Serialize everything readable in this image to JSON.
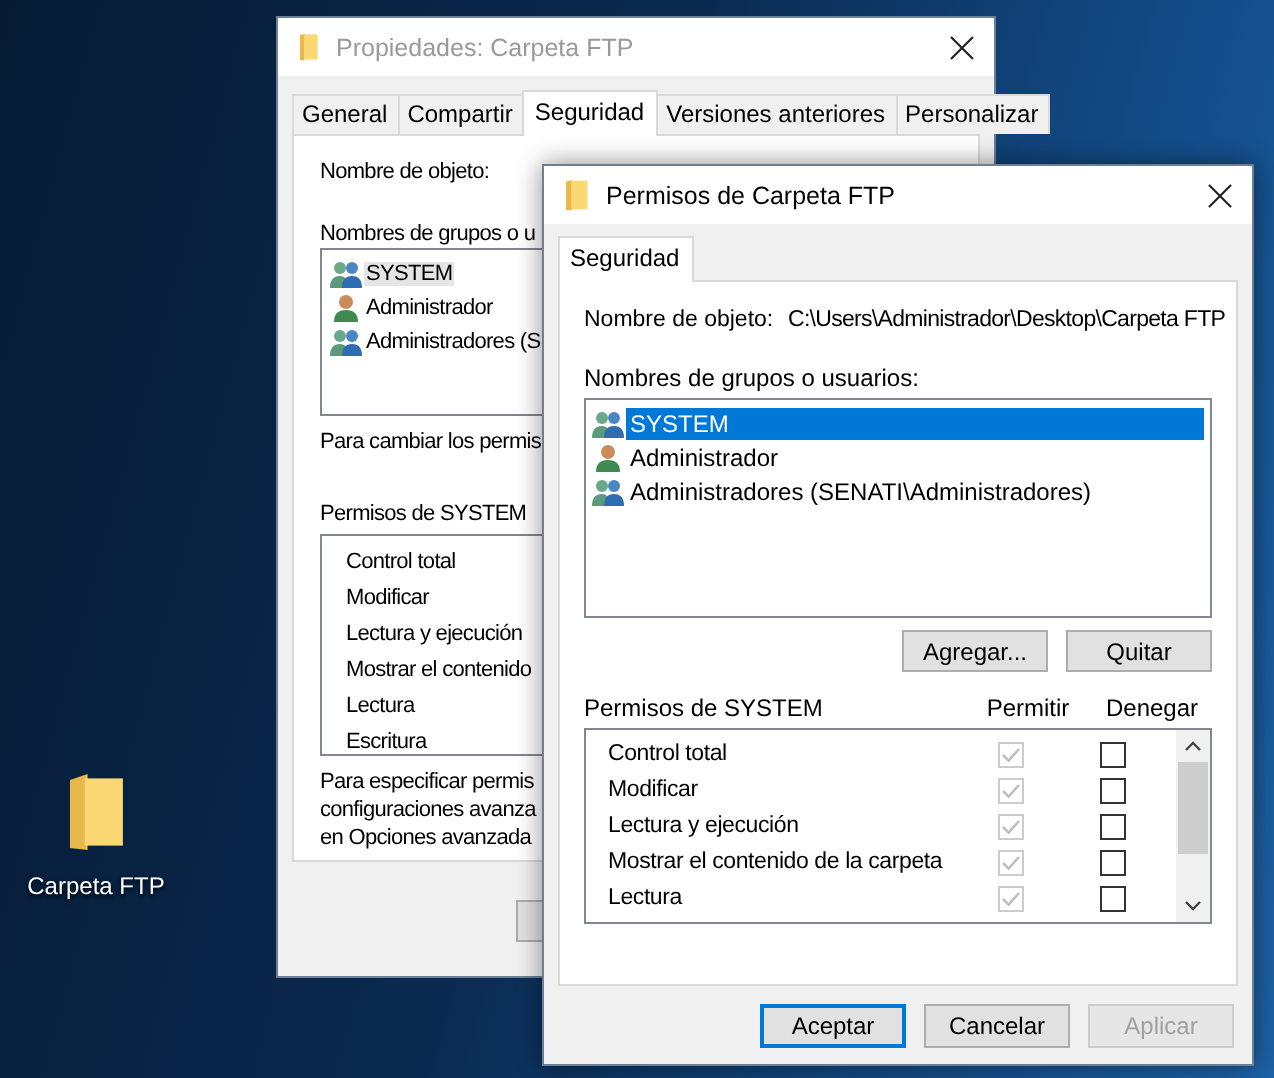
{
  "desktop": {
    "icons": [
      {
        "label": "Carpeta FTP"
      }
    ]
  },
  "back_window": {
    "title": "Propiedades: Carpeta FTP",
    "tabs": [
      {
        "label": "General",
        "selected": false
      },
      {
        "label": "Compartir",
        "selected": false
      },
      {
        "label": "Seguridad",
        "selected": true
      },
      {
        "label": "Versiones anteriores",
        "selected": false
      },
      {
        "label": "Personalizar",
        "selected": false
      }
    ],
    "object_label": "Nombre de objeto:",
    "groups_label": "Nombres de grupos o u",
    "groups": [
      {
        "name": "SYSTEM",
        "kind": "group",
        "selected": true
      },
      {
        "name": "Administrador",
        "kind": "user",
        "selected": false
      },
      {
        "name": "Administradores (S",
        "kind": "group",
        "selected": false
      }
    ],
    "change_note": "Para cambiar los permis",
    "permissions_label": "Permisos de SYSTEM",
    "permissions": [
      "Control total",
      "Modificar",
      "Lectura y ejecución",
      "Mostrar el contenido",
      "Lectura",
      "Escritura"
    ],
    "advanced_note": [
      "Para especificar permis",
      "configuraciones avanza",
      "en Opciones avanzada"
    ]
  },
  "front_window": {
    "title": "Permisos de Carpeta FTP",
    "tabs": [
      {
        "label": "Seguridad",
        "selected": true
      }
    ],
    "object_label": "Nombre de objeto:",
    "object_path": "C:\\Users\\Administrador\\Desktop\\Carpeta FTP",
    "groups_label": "Nombres de grupos o usuarios:",
    "groups": [
      {
        "name": "SYSTEM",
        "kind": "group",
        "selected": true
      },
      {
        "name": "Administrador",
        "kind": "user",
        "selected": false
      },
      {
        "name": "Administradores (SENATI\\Administradores)",
        "kind": "group",
        "selected": false
      }
    ],
    "group_buttons": [
      "Agregar...",
      "Quitar"
    ],
    "permissions_label": "Permisos de SYSTEM",
    "allow_label": "Permitir",
    "deny_label": "Denegar",
    "permissions": [
      {
        "name": "Control total",
        "allow": {
          "checked": true,
          "disabled": true
        },
        "deny": {
          "checked": false,
          "disabled": false
        }
      },
      {
        "name": "Modificar",
        "allow": {
          "checked": true,
          "disabled": true
        },
        "deny": {
          "checked": false,
          "disabled": false
        }
      },
      {
        "name": "Lectura y ejecución",
        "allow": {
          "checked": true,
          "disabled": true
        },
        "deny": {
          "checked": false,
          "disabled": false
        }
      },
      {
        "name": "Mostrar el contenido de la carpeta",
        "allow": {
          "checked": true,
          "disabled": true
        },
        "deny": {
          "checked": false,
          "disabled": false
        }
      },
      {
        "name": "Lectura",
        "allow": {
          "checked": true,
          "disabled": true
        },
        "deny": {
          "checked": false,
          "disabled": false
        }
      }
    ],
    "buttons": [
      {
        "label": "Aceptar",
        "focused": true,
        "disabled": false
      },
      {
        "label": "Cancelar",
        "focused": false,
        "disabled": false
      },
      {
        "label": "Aplicar",
        "focused": false,
        "disabled": true
      }
    ]
  }
}
